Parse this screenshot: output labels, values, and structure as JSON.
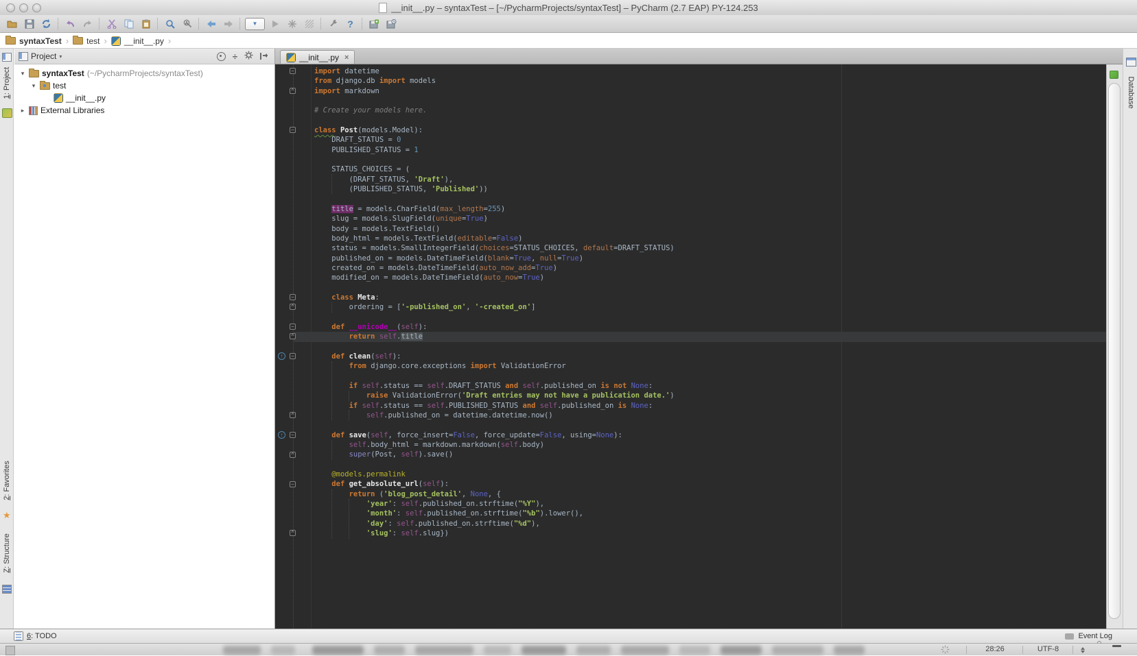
{
  "window": {
    "title": "__init__.py – syntaxTest – [~/PycharmProjects/syntaxTest] – PyCharm (2.7 EAP) PY-124.253"
  },
  "toolbar": {
    "icon_names": [
      "open-folder-icon",
      "save-all-icon",
      "synchronize-icon",
      "undo-icon",
      "redo-icon",
      "cut-icon",
      "copy-icon",
      "paste-icon",
      "find-icon",
      "replace-icon",
      "nav-back-icon",
      "nav-forward-icon",
      "run-config-dropdown",
      "run-icon",
      "coverage-icon",
      "profile-grid-icon",
      "settings-wrench-icon",
      "help-icon",
      "export-settings-icon",
      "import-settings-icon"
    ]
  },
  "breadcrumbs": {
    "items": [
      {
        "label": "syntaxTest"
      },
      {
        "label": "test"
      },
      {
        "label": "__init__.py"
      }
    ]
  },
  "ui": {
    "chevron": "›"
  },
  "icons": {
    "expanded": "▾",
    "collapsed": "▸",
    "dropdown": "▾",
    "run_dropdown": "▼",
    "fold_open": "−",
    "fold_end": "^",
    "override_arrow": "↑",
    "star": "★",
    "help": "?",
    "close": "×",
    "collapse_all": "÷",
    "run_play": "▶"
  },
  "stripes": {
    "left_top": {
      "num": "1",
      "rest": ": Project"
    },
    "favorites": {
      "num": "2",
      "rest": ": Favorites"
    },
    "structure": {
      "num": "Z",
      "rest": ": Structure"
    },
    "database": {
      "label": "Database"
    }
  },
  "project_panel": {
    "title": "Project",
    "tree": [
      {
        "name": "syntaxTest",
        "path": "(~/PycharmProjects/syntaxTest)",
        "expanded": true
      },
      {
        "name": "test",
        "expanded": true
      },
      {
        "name": "__init__.py"
      },
      {
        "name": "External Libraries",
        "expanded": false
      }
    ]
  },
  "editor": {
    "tab_label": "__init__.py",
    "lines": [
      {
        "t": [
          [
            "k",
            "import"
          ],
          [
            "p",
            " datetime"
          ]
        ],
        "fold": "open"
      },
      {
        "t": [
          [
            "k",
            "from"
          ],
          [
            "p",
            " django.db "
          ],
          [
            "k",
            "import"
          ],
          [
            "p",
            " models"
          ]
        ]
      },
      {
        "t": [
          [
            "k",
            "import"
          ],
          [
            "p",
            " markdown"
          ]
        ],
        "fold": "end"
      },
      {},
      {
        "t": [
          [
            "c",
            "# Create your models here."
          ]
        ]
      },
      {},
      {
        "t": [
          [
            "kwavy",
            "class"
          ],
          [
            "p",
            " "
          ],
          [
            "f",
            "Post"
          ],
          [
            "p",
            "(models.Model):"
          ]
        ],
        "fold": "open"
      },
      {
        "t": [
          [
            "p",
            "    DRAFT_STATUS = "
          ],
          [
            "n",
            "0"
          ]
        ]
      },
      {
        "t": [
          [
            "p",
            "    PUBLISHED_STATUS = "
          ],
          [
            "n",
            "1"
          ]
        ]
      },
      {},
      {
        "t": [
          [
            "p",
            "    STATUS_CHOICES = ("
          ]
        ]
      },
      {
        "t": [
          [
            "p",
            "        (DRAFT_STATUS, "
          ],
          [
            "s",
            "'Draft'"
          ],
          [
            "p",
            "),"
          ]
        ]
      },
      {
        "t": [
          [
            "p",
            "        (PUBLISHED_STATUS, "
          ],
          [
            "s",
            "'Published'"
          ],
          [
            "p",
            "))"
          ]
        ]
      },
      {},
      {
        "t": [
          [
            "p",
            "    "
          ],
          [
            "tw",
            "title"
          ],
          [
            "p",
            " = models.CharField("
          ],
          [
            "a",
            "max_length"
          ],
          [
            "p",
            "="
          ],
          [
            "n",
            "255"
          ],
          [
            "p",
            ")"
          ]
        ]
      },
      {
        "t": [
          [
            "p",
            "    slug = models.SlugField("
          ],
          [
            "a",
            "unique"
          ],
          [
            "p",
            "="
          ],
          [
            "b",
            "True"
          ],
          [
            "p",
            ")"
          ]
        ]
      },
      {
        "t": [
          [
            "p",
            "    body = models.TextField()"
          ]
        ]
      },
      {
        "t": [
          [
            "p",
            "    body_html = models.TextField("
          ],
          [
            "a",
            "editable"
          ],
          [
            "p",
            "="
          ],
          [
            "b",
            "False"
          ],
          [
            "p",
            ")"
          ]
        ]
      },
      {
        "t": [
          [
            "p",
            "    status = models.SmallIntegerField("
          ],
          [
            "a",
            "choices"
          ],
          [
            "p",
            "=STATUS_CHOICES, "
          ],
          [
            "a",
            "default"
          ],
          [
            "p",
            "=DRAFT_STATUS)"
          ]
        ]
      },
      {
        "t": [
          [
            "p",
            "    published_on = models.DateTimeField("
          ],
          [
            "a",
            "blank"
          ],
          [
            "p",
            "="
          ],
          [
            "b",
            "True"
          ],
          [
            "p",
            ", "
          ],
          [
            "a",
            "null"
          ],
          [
            "p",
            "="
          ],
          [
            "b",
            "True"
          ],
          [
            "p",
            ")"
          ]
        ]
      },
      {
        "t": [
          [
            "p",
            "    created_on = models.DateTimeField("
          ],
          [
            "a",
            "auto_now_add"
          ],
          [
            "p",
            "="
          ],
          [
            "b",
            "True"
          ],
          [
            "p",
            ")"
          ]
        ]
      },
      {
        "t": [
          [
            "p",
            "    modified_on = models.DateTimeField("
          ],
          [
            "a",
            "auto_now"
          ],
          [
            "p",
            "="
          ],
          [
            "b",
            "True"
          ],
          [
            "p",
            ")"
          ]
        ]
      },
      {},
      {
        "t": [
          [
            "p",
            "    "
          ],
          [
            "k",
            "class"
          ],
          [
            "p",
            " "
          ],
          [
            "f",
            "Meta"
          ],
          [
            "p",
            ":"
          ]
        ],
        "fold": "open"
      },
      {
        "t": [
          [
            "p",
            "        ordering = ["
          ],
          [
            "s",
            "'-published_on'"
          ],
          [
            "p",
            ", "
          ],
          [
            "s",
            "'-created_on'"
          ],
          [
            "p",
            "]"
          ]
        ],
        "fold": "end"
      },
      {},
      {
        "t": [
          [
            "p",
            "    "
          ],
          [
            "k",
            "def"
          ],
          [
            "p",
            " "
          ],
          [
            "m",
            "__unicode__"
          ],
          [
            "p",
            "("
          ],
          [
            "se",
            "self"
          ],
          [
            "p",
            "):"
          ]
        ],
        "fold": "open"
      },
      {
        "t": [
          [
            "p",
            "        "
          ],
          [
            "k",
            "return"
          ],
          [
            "p",
            " "
          ],
          [
            "se",
            "self"
          ],
          [
            "p",
            "."
          ],
          [
            "tr",
            "title"
          ]
        ],
        "fold": "end",
        "cur": true
      },
      {},
      {
        "t": [
          [
            "p",
            "    "
          ],
          [
            "k",
            "def"
          ],
          [
            "p",
            " "
          ],
          [
            "f",
            "clean"
          ],
          [
            "p",
            "("
          ],
          [
            "se",
            "self"
          ],
          [
            "p",
            "):"
          ]
        ],
        "fold": "open",
        "ovr": true
      },
      {
        "t": [
          [
            "p",
            "        "
          ],
          [
            "k",
            "from"
          ],
          [
            "p",
            " django.core.exceptions "
          ],
          [
            "k",
            "import"
          ],
          [
            "p",
            " ValidationError"
          ]
        ]
      },
      {},
      {
        "t": [
          [
            "p",
            "        "
          ],
          [
            "k",
            "if"
          ],
          [
            "p",
            " "
          ],
          [
            "se",
            "self"
          ],
          [
            "p",
            ".status == "
          ],
          [
            "se",
            "self"
          ],
          [
            "p",
            ".DRAFT_STATUS "
          ],
          [
            "k",
            "and"
          ],
          [
            "p",
            " "
          ],
          [
            "se",
            "self"
          ],
          [
            "p",
            ".published_on "
          ],
          [
            "k",
            "is"
          ],
          [
            "p",
            " "
          ],
          [
            "k",
            "not"
          ],
          [
            "p",
            " "
          ],
          [
            "b",
            "None"
          ],
          [
            "p",
            ":"
          ]
        ]
      },
      {
        "t": [
          [
            "p",
            "            "
          ],
          [
            "k",
            "raise"
          ],
          [
            "p",
            " ValidationError("
          ],
          [
            "s",
            "'Draft entries may not have a publication date.'"
          ],
          [
            "p",
            ")"
          ]
        ]
      },
      {
        "t": [
          [
            "p",
            "        "
          ],
          [
            "k",
            "if"
          ],
          [
            "p",
            " "
          ],
          [
            "se",
            "self"
          ],
          [
            "p",
            ".status == "
          ],
          [
            "se",
            "self"
          ],
          [
            "p",
            ".PUBLISHED_STATUS "
          ],
          [
            "k",
            "and"
          ],
          [
            "p",
            " "
          ],
          [
            "se",
            "self"
          ],
          [
            "p",
            ".published_on "
          ],
          [
            "k",
            "is"
          ],
          [
            "p",
            " "
          ],
          [
            "b",
            "None"
          ],
          [
            "p",
            ":"
          ]
        ]
      },
      {
        "t": [
          [
            "p",
            "            "
          ],
          [
            "se",
            "self"
          ],
          [
            "p",
            ".published_on = datetime.datetime.now()"
          ]
        ],
        "fold": "end"
      },
      {},
      {
        "t": [
          [
            "p",
            "    "
          ],
          [
            "k",
            "def"
          ],
          [
            "p",
            " "
          ],
          [
            "f",
            "save"
          ],
          [
            "p",
            "("
          ],
          [
            "se",
            "self"
          ],
          [
            "p",
            ", force_insert="
          ],
          [
            "b",
            "False"
          ],
          [
            "p",
            ", force_update="
          ],
          [
            "b",
            "False"
          ],
          [
            "p",
            ", using="
          ],
          [
            "b",
            "None"
          ],
          [
            "p",
            "):"
          ]
        ],
        "fold": "open",
        "ovr": true
      },
      {
        "t": [
          [
            "p",
            "        "
          ],
          [
            "se",
            "self"
          ],
          [
            "p",
            ".body_html = markdown.markdown("
          ],
          [
            "se",
            "self"
          ],
          [
            "p",
            ".body)"
          ]
        ]
      },
      {
        "t": [
          [
            "p",
            "        "
          ],
          [
            "su",
            "super"
          ],
          [
            "p",
            "(Post, "
          ],
          [
            "se",
            "self"
          ],
          [
            "p",
            ").save()"
          ]
        ],
        "fold": "end"
      },
      {},
      {
        "t": [
          [
            "p",
            "    "
          ],
          [
            "d",
            "@models.permalink"
          ]
        ]
      },
      {
        "t": [
          [
            "p",
            "    "
          ],
          [
            "k",
            "def"
          ],
          [
            "p",
            " "
          ],
          [
            "f",
            "get_absolute_url"
          ],
          [
            "p",
            "("
          ],
          [
            "se",
            "self"
          ],
          [
            "p",
            "):"
          ]
        ],
        "fold": "open"
      },
      {
        "t": [
          [
            "p",
            "        "
          ],
          [
            "k",
            "return"
          ],
          [
            "p",
            " ("
          ],
          [
            "s",
            "'blog_post_detail'"
          ],
          [
            "p",
            ", "
          ],
          [
            "b",
            "None"
          ],
          [
            "p",
            ", {"
          ]
        ]
      },
      {
        "t": [
          [
            "p",
            "            "
          ],
          [
            "s",
            "'year'"
          ],
          [
            "p",
            ": "
          ],
          [
            "se",
            "self"
          ],
          [
            "p",
            ".published_on.strftime("
          ],
          [
            "s",
            "\"%Y\""
          ],
          [
            "p",
            "),"
          ]
        ]
      },
      {
        "t": [
          [
            "p",
            "            "
          ],
          [
            "s",
            "'month'"
          ],
          [
            "p",
            ": "
          ],
          [
            "se",
            "self"
          ],
          [
            "p",
            ".published_on.strftime("
          ],
          [
            "s",
            "\"%b\""
          ],
          [
            "p",
            ").lower(),"
          ]
        ]
      },
      {
        "t": [
          [
            "p",
            "            "
          ],
          [
            "s",
            "'day'"
          ],
          [
            "p",
            ": "
          ],
          [
            "se",
            "self"
          ],
          [
            "p",
            ".published_on.strftime("
          ],
          [
            "s",
            "\"%d\""
          ],
          [
            "p",
            "),"
          ]
        ]
      },
      {
        "t": [
          [
            "p",
            "            "
          ],
          [
            "s",
            "'slug'"
          ],
          [
            "p",
            ": "
          ],
          [
            "se",
            "self"
          ],
          [
            "p",
            ".slug})"
          ]
        ],
        "fold": "end"
      }
    ]
  },
  "bottom_bar": {
    "todo_num": "6",
    "todo_rest": ": TODO",
    "event_log": "Event Log"
  },
  "status_bar": {
    "caret": "28:26",
    "encoding": "UTF-8"
  },
  "colors": {
    "editor_bg": "#2B2B2B",
    "kw": "#CC7832",
    "plain": "#A9B7C6",
    "comment": "#7F7F7F",
    "string": "#A5C261",
    "number": "#6897BB",
    "param": "#B3774E",
    "predef": "#5C63C5",
    "self_c": "#94558D",
    "magic": "#B200B2",
    "decorator": "#BBB529",
    "builtin": "#8888C6",
    "func": "#E8E8E8",
    "write_bg": "#6E2B66",
    "read_bg": "#4E5254",
    "caret_line": "#37393B",
    "indicator_green": "#59A23B"
  }
}
